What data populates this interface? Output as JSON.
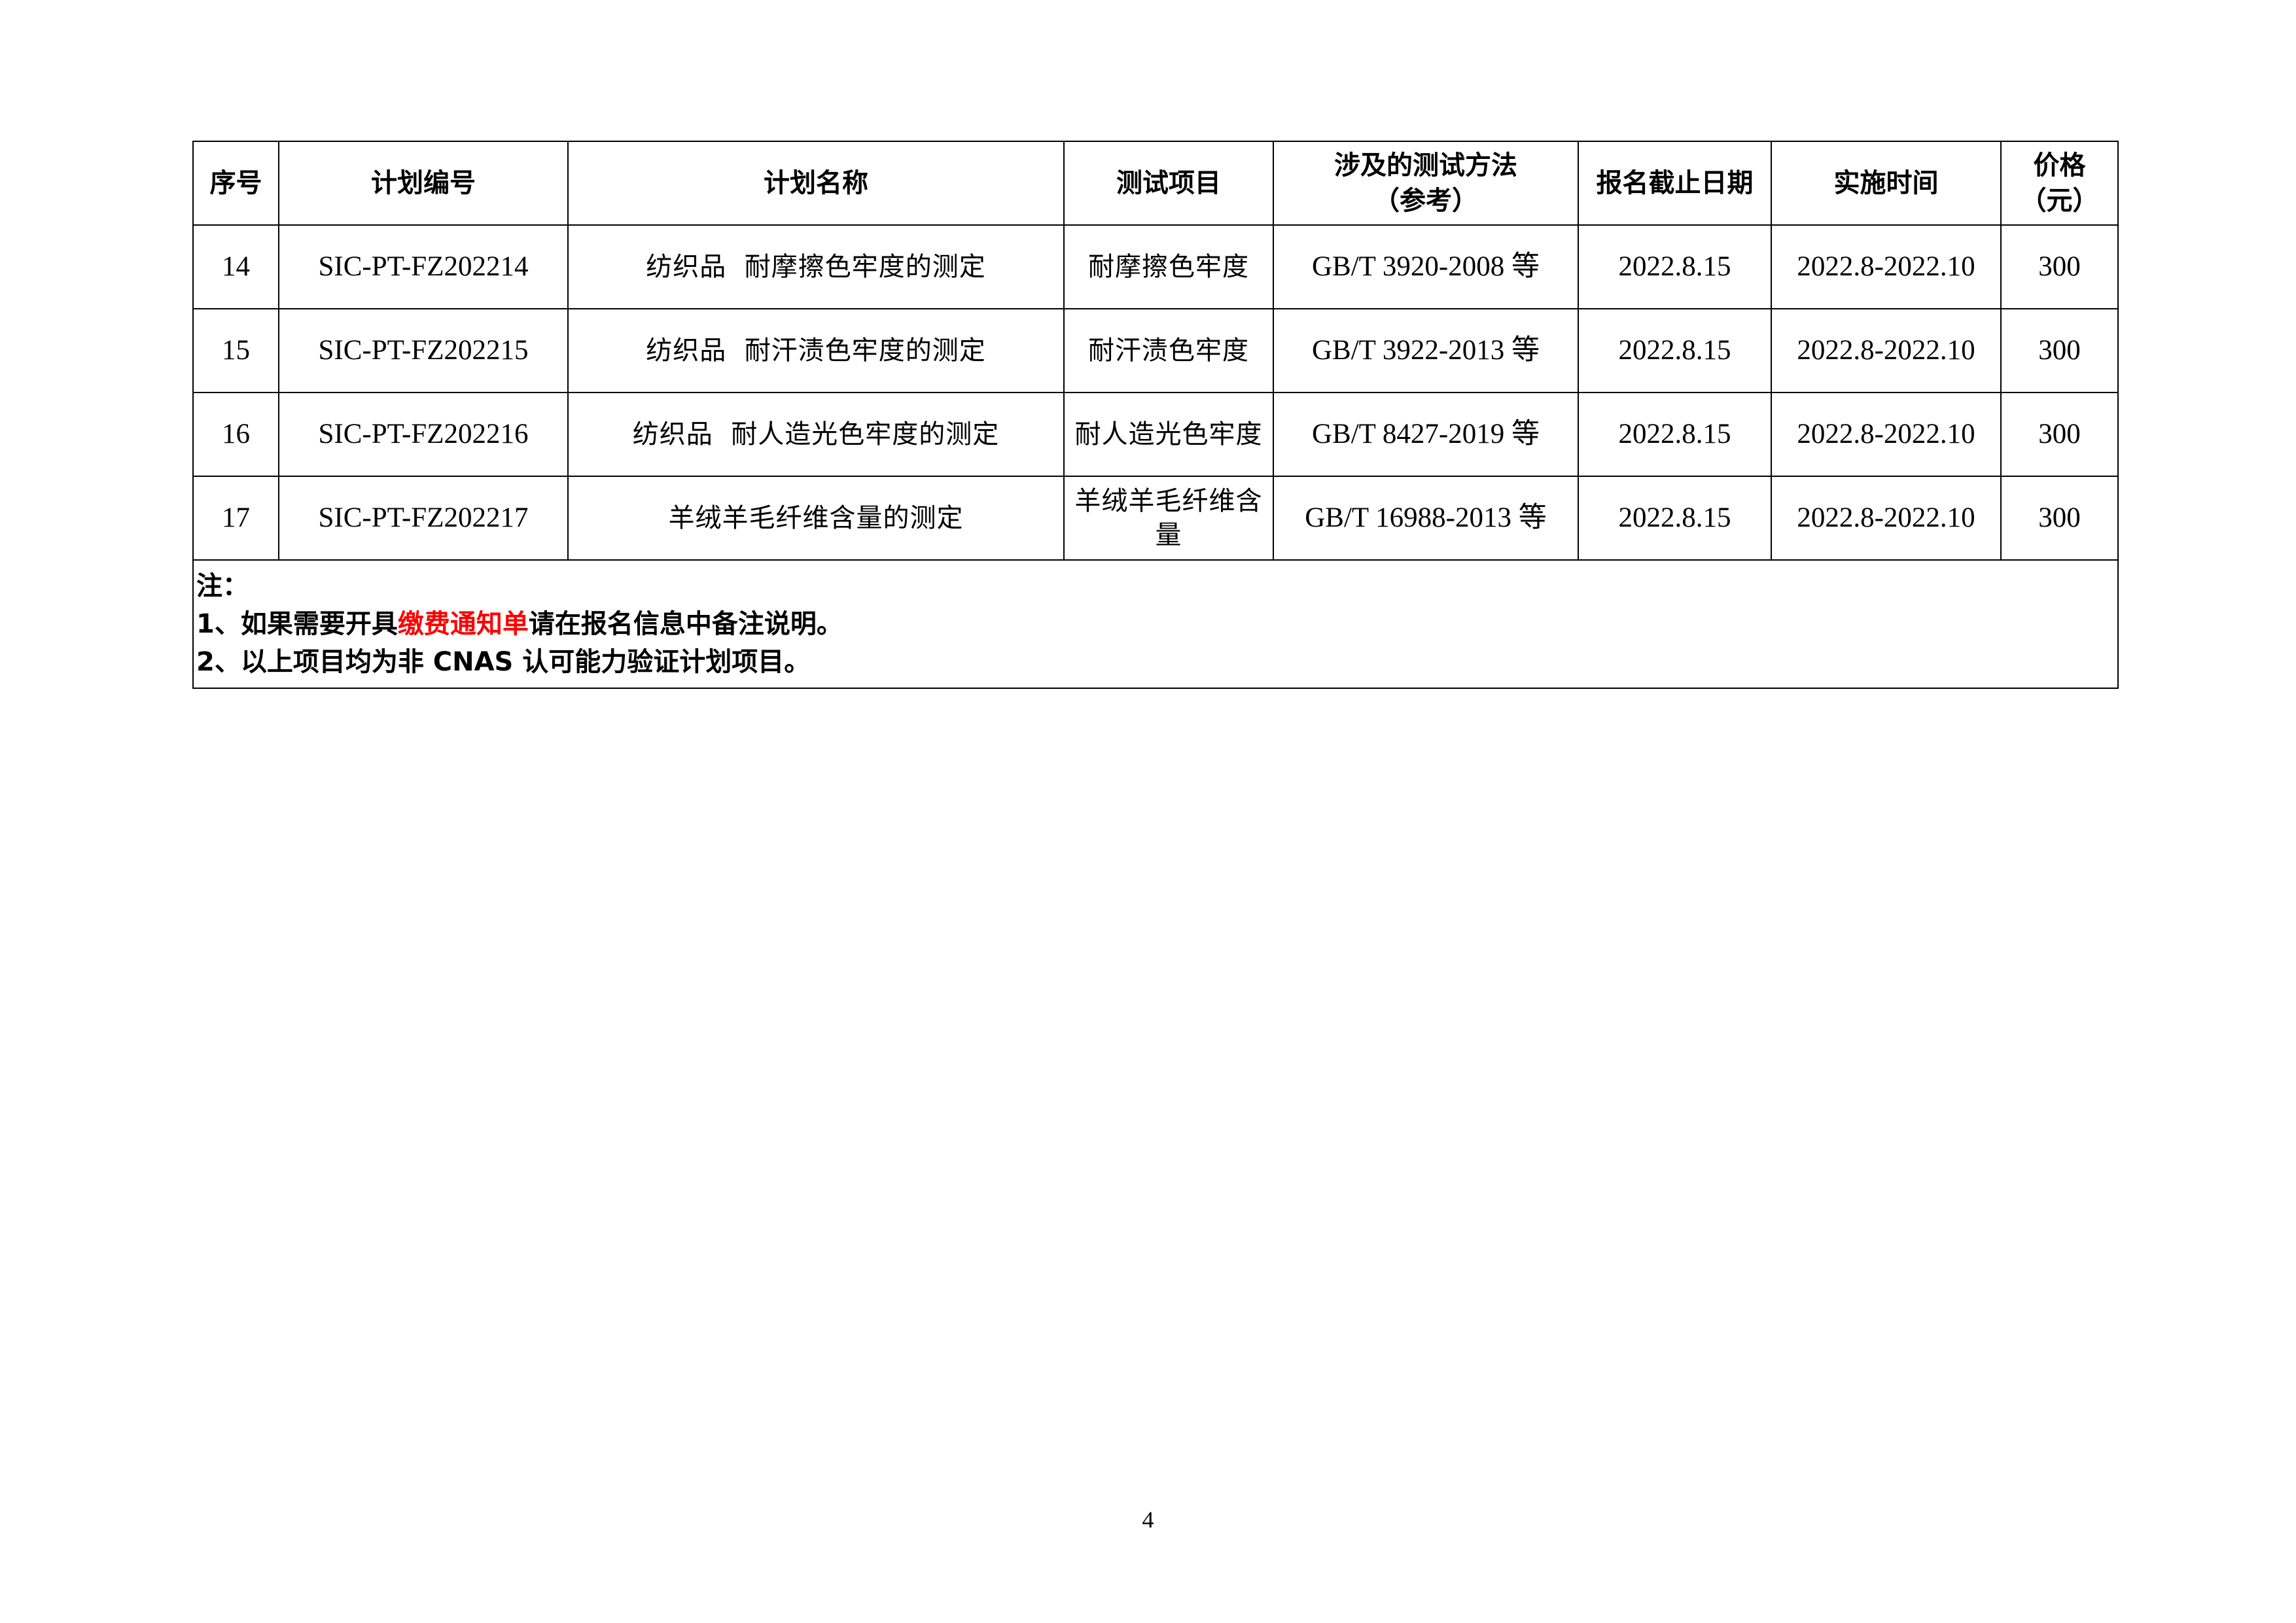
{
  "table": {
    "headers": [
      "序号",
      "计划编号",
      "计划名称",
      "测试项目",
      "涉及的测试方法",
      "（参考）",
      "报名截止日期",
      "实施时间",
      "价格",
      "（元）"
    ],
    "rows": [
      {
        "no": "14",
        "code": "SIC-PT-FZ202214",
        "name": "纺织品  耐摩擦色牢度的测定",
        "item": "耐摩擦色牢度",
        "method": "GB/T 3920-2008 等",
        "deadline": "2022.8.15",
        "period": "2022.8-2022.10",
        "price": "300"
      },
      {
        "no": "15",
        "code": "SIC-PT-FZ202215",
        "name": "纺织品  耐汗渍色牢度的测定",
        "item": "耐汗渍色牢度",
        "method": "GB/T 3922-2013 等",
        "deadline": "2022.8.15",
        "period": "2022.8-2022.10",
        "price": "300"
      },
      {
        "no": "16",
        "code": "SIC-PT-FZ202216",
        "name": "纺织品  耐人造光色牢度的测定",
        "item": "耐人造光色牢度",
        "method": "GB/T 8427-2019 等",
        "deadline": "2022.8.15",
        "period": "2022.8-2022.10",
        "price": "300"
      },
      {
        "no": "17",
        "code": "SIC-PT-FZ202217",
        "name": "羊绒羊毛纤维含量的测定",
        "item": "羊绒羊毛纤维含量",
        "method": "GB/T 16988-2013 等",
        "deadline": "2022.8.15",
        "period": "2022.8-2022.10",
        "price": "300"
      }
    ]
  },
  "notes": {
    "title": "注：",
    "line1_prefix": "1、如果需要开具",
    "line1_highlight": "缴费通知单",
    "line1_suffix": "请在报名信息中备注说明。",
    "line2": "2、以上项目均为非 CNAS 认可能力验证计划项目。"
  },
  "highlight_color": "#ff0000",
  "page_number": "4"
}
